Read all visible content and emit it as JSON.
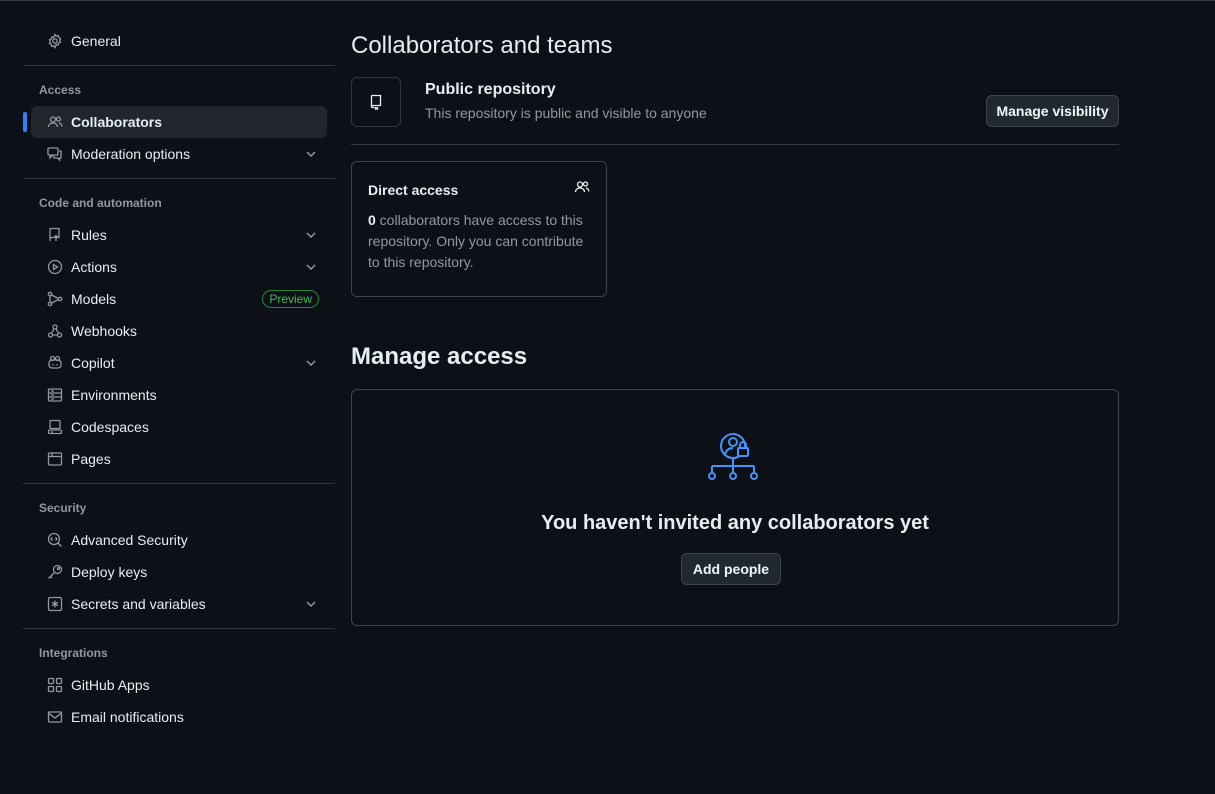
{
  "sidebar": {
    "general": {
      "label": "General",
      "icon": "gear-icon"
    },
    "groups": [
      {
        "title": "Access",
        "items": [
          {
            "label": "Collaborators",
            "icon": "people-icon",
            "active": true
          },
          {
            "label": "Moderation options",
            "icon": "comment-discussion-icon",
            "expandable": true
          }
        ]
      },
      {
        "title": "Code and automation",
        "items": [
          {
            "label": "Rules",
            "icon": "repo-push-icon",
            "expandable": true
          },
          {
            "label": "Actions",
            "icon": "play-icon",
            "expandable": true
          },
          {
            "label": "Models",
            "icon": "ai-model-icon",
            "badge": "Preview"
          },
          {
            "label": "Webhooks",
            "icon": "webhook-icon"
          },
          {
            "label": "Copilot",
            "icon": "copilot-icon",
            "expandable": true
          },
          {
            "label": "Environments",
            "icon": "server-icon"
          },
          {
            "label": "Codespaces",
            "icon": "codespaces-icon"
          },
          {
            "label": "Pages",
            "icon": "browser-icon"
          }
        ]
      },
      {
        "title": "Security",
        "items": [
          {
            "label": "Advanced Security",
            "icon": "codescan-icon"
          },
          {
            "label": "Deploy keys",
            "icon": "key-icon"
          },
          {
            "label": "Secrets and variables",
            "icon": "key-asterisk-icon",
            "expandable": true
          }
        ]
      },
      {
        "title": "Integrations",
        "items": [
          {
            "label": "GitHub Apps",
            "icon": "apps-icon"
          },
          {
            "label": "Email notifications",
            "icon": "mail-icon"
          }
        ]
      }
    ]
  },
  "main": {
    "title": "Collaborators and teams",
    "visibility": {
      "title": "Public repository",
      "description": "This repository is public and visible to anyone",
      "button": "Manage visibility"
    },
    "direct_access": {
      "title": "Direct access",
      "count": "0",
      "text": " collaborators have access to this repository. Only you can contribute to this repository."
    },
    "manage_access": {
      "title": "Manage access",
      "empty_title": "You haven't invited any collaborators yet",
      "button": "Add people"
    }
  },
  "colors": {
    "background": "#0d1117",
    "accent": "#2f81f7",
    "border": "#30363d",
    "muted": "#9198a1",
    "preview_badge": "#3fb950"
  }
}
